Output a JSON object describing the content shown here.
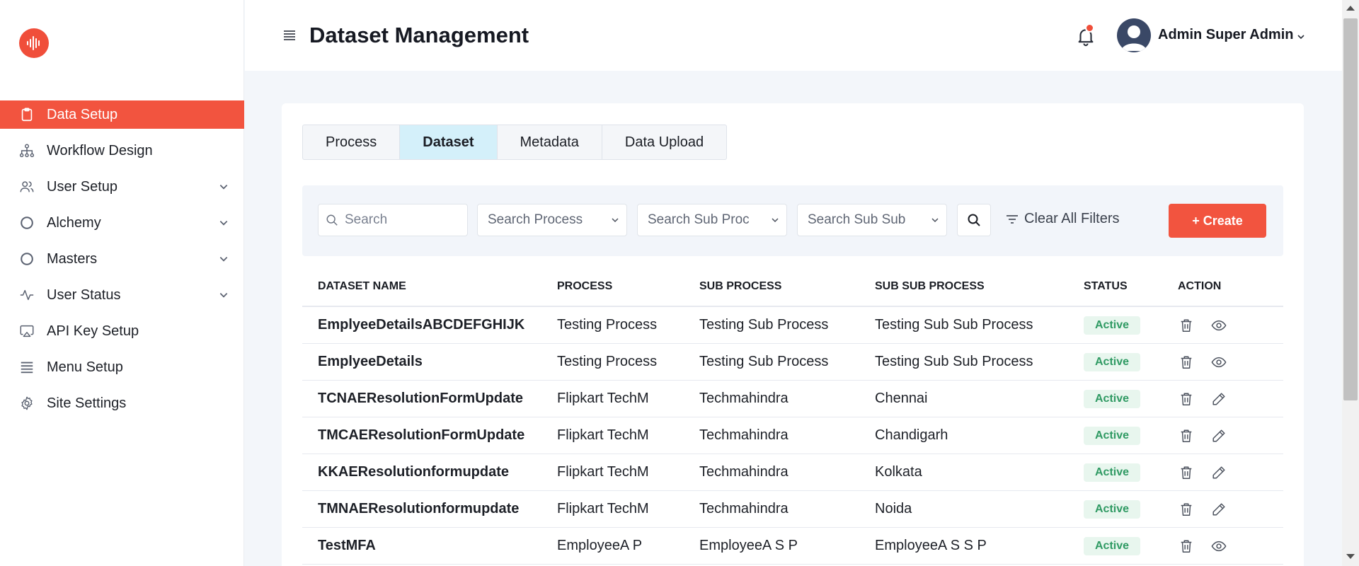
{
  "sidebar": {
    "logo": "audio-wave-logo",
    "items": [
      {
        "label": "Data Setup",
        "icon": "clipboard-icon",
        "active": true,
        "expandable": false
      },
      {
        "label": "Workflow Design",
        "icon": "hierarchy-icon",
        "active": false,
        "expandable": false
      },
      {
        "label": "User Setup",
        "icon": "users-icon",
        "active": false,
        "expandable": true
      },
      {
        "label": "Alchemy",
        "icon": "circle-icon",
        "active": false,
        "expandable": true
      },
      {
        "label": "Masters",
        "icon": "circle-icon",
        "active": false,
        "expandable": true
      },
      {
        "label": "User Status",
        "icon": "activity-icon",
        "active": false,
        "expandable": true
      },
      {
        "label": "API Key Setup",
        "icon": "airplay-icon",
        "active": false,
        "expandable": false
      },
      {
        "label": "Menu Setup",
        "icon": "list-icon",
        "active": false,
        "expandable": false
      },
      {
        "label": "Site Settings",
        "icon": "gear-icon",
        "active": false,
        "expandable": false
      }
    ]
  },
  "header": {
    "title": "Dataset Management",
    "user_name": "Admin Super Admin"
  },
  "tabs": [
    {
      "label": "Process",
      "active": false
    },
    {
      "label": "Dataset",
      "active": true
    },
    {
      "label": "Metadata",
      "active": false
    },
    {
      "label": "Data Upload",
      "active": false
    }
  ],
  "filters": {
    "search_placeholder": "Search",
    "process_placeholder": "Search Process",
    "sub_process_placeholder": "Search Sub Proc",
    "sub_sub_process_placeholder": "Search Sub Sub",
    "clear_label": "Clear All Filters",
    "create_label": "+ Create"
  },
  "table": {
    "columns": [
      "DATASET NAME",
      "PROCESS",
      "SUB PROCESS",
      "SUB SUB PROCESS",
      "STATUS",
      "ACTION"
    ],
    "rows": [
      {
        "name": "EmplyeeDetailsABCDEFGHIJK",
        "process": "Testing Process",
        "sub_process": "Testing Sub Process",
        "sub_sub_process": "Testing Sub Sub Process",
        "status": "Active",
        "second_action": "eye-icon"
      },
      {
        "name": "EmplyeeDetails",
        "process": "Testing Process",
        "sub_process": "Testing Sub Process",
        "sub_sub_process": "Testing Sub Sub Process",
        "status": "Active",
        "second_action": "eye-icon"
      },
      {
        "name": "TCNAEResolutionFormUpdate",
        "process": "Flipkart TechM",
        "sub_process": "Techmahindra",
        "sub_sub_process": "Chennai",
        "status": "Active",
        "second_action": "pencil-icon"
      },
      {
        "name": "TMCAEResolutionFormUpdate",
        "process": "Flipkart TechM",
        "sub_process": "Techmahindra",
        "sub_sub_process": "Chandigarh",
        "status": "Active",
        "second_action": "pencil-icon"
      },
      {
        "name": "KKAEResolutionformupdate",
        "process": "Flipkart TechM",
        "sub_process": "Techmahindra",
        "sub_sub_process": "Kolkata",
        "status": "Active",
        "second_action": "pencil-icon"
      },
      {
        "name": "TMNAEResolutionformupdate",
        "process": "Flipkart TechM",
        "sub_process": "Techmahindra",
        "sub_sub_process": "Noida",
        "status": "Active",
        "second_action": "pencil-icon"
      },
      {
        "name": "TestMFA",
        "process": "EmployeeA P",
        "sub_process": "EmployeeA S P",
        "sub_sub_process": "EmployeeA S S P",
        "status": "Active",
        "second_action": "eye-icon"
      }
    ]
  },
  "colors": {
    "accent": "#f2543f",
    "active_tab": "#d4f0fa",
    "status_bg": "#e8f6ee",
    "status_text": "#2f9a63"
  }
}
